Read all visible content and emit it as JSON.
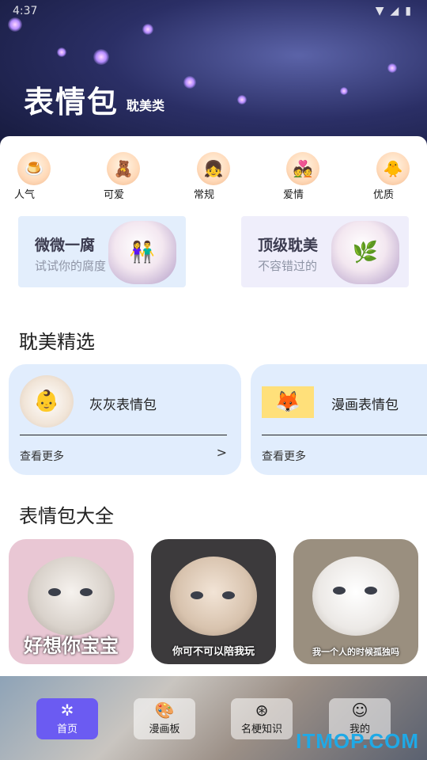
{
  "status_bar": {
    "time": "4:37"
  },
  "header": {
    "title": "表情包",
    "subtitle": "耽美类"
  },
  "categories": [
    {
      "label": "人气",
      "icon": "pudding-icon"
    },
    {
      "label": "可爱",
      "icon": "bear-icon"
    },
    {
      "label": "常规",
      "icon": "girl-icon"
    },
    {
      "label": "爱情",
      "icon": "couple-icon"
    },
    {
      "label": "优质",
      "icon": "duck-icon"
    }
  ],
  "promos": [
    {
      "title": "微微一腐",
      "subtitle": "试试你的腐度",
      "bg": "#e3eefc"
    },
    {
      "title": "顶级耽美",
      "subtitle": "不容错过的",
      "bg": "#efeefb"
    }
  ],
  "featured": {
    "title": "耽美精选",
    "items": [
      {
        "name": "灰灰表情包",
        "more": "查看更多",
        "arrow": ">"
      },
      {
        "name": "漫画表情包",
        "more": "查看更多",
        "arrow": ">"
      }
    ]
  },
  "memes": {
    "title": "表情包大全",
    "items": [
      {
        "caption": "好想你宝宝",
        "bg": "#e9c7d4"
      },
      {
        "caption": "你可不可以陪我玩",
        "bg": "#3c3a3c"
      },
      {
        "caption": "我一个人的时候孤独吗",
        "bg": "#9a8f7f"
      }
    ]
  },
  "nav": [
    {
      "label": "首页",
      "icon": "home-icon",
      "active": true
    },
    {
      "label": "漫画板",
      "icon": "palette-icon",
      "active": false
    },
    {
      "label": "名梗知识",
      "icon": "film-reel-icon",
      "active": false
    },
    {
      "label": "我的",
      "icon": "android-icon",
      "active": false
    }
  ],
  "watermark": "ITMOP.COM",
  "colors": {
    "accent": "#6b5bf2",
    "card": "#e1edfd",
    "watermark": "#1fa9e6"
  }
}
